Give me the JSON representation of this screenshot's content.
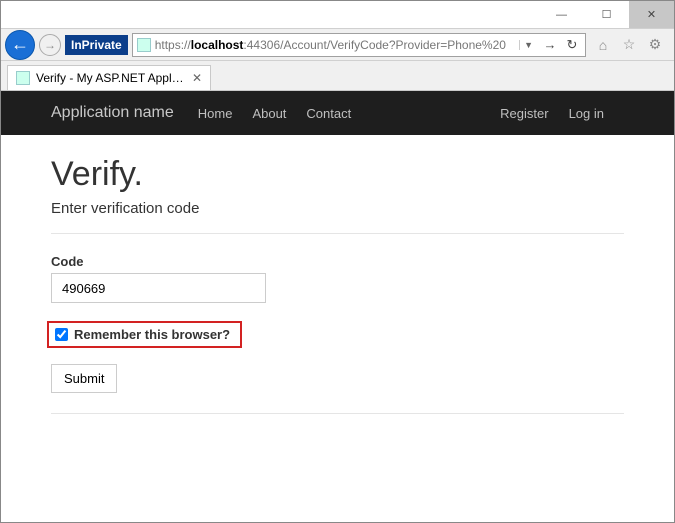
{
  "window": {
    "minimize": "—",
    "maximize": "☐",
    "close": "✕"
  },
  "toolbar": {
    "inprivate_label": "InPrivate",
    "url_prefix": "https://",
    "url_host": "localhost",
    "url_rest": ":44306/Account/VerifyCode?Provider=Phone%20",
    "back": "←",
    "fwd": "→",
    "dropdown": "▼",
    "go": "→",
    "refresh": "↻",
    "icons": {
      "home": "⌂",
      "star": "☆",
      "gear": "⚙"
    }
  },
  "tab": {
    "label": "Verify - My ASP.NET Applic...",
    "close": "✕"
  },
  "navbar": {
    "brand": "Application name",
    "links": [
      "Home",
      "About",
      "Contact"
    ],
    "right": [
      "Register",
      "Log in"
    ]
  },
  "verify": {
    "title": "Verify.",
    "subtitle": "Enter verification code",
    "code_label": "Code",
    "code_value": "490669",
    "remember_label": "Remember this browser?",
    "submit_label": "Submit"
  }
}
